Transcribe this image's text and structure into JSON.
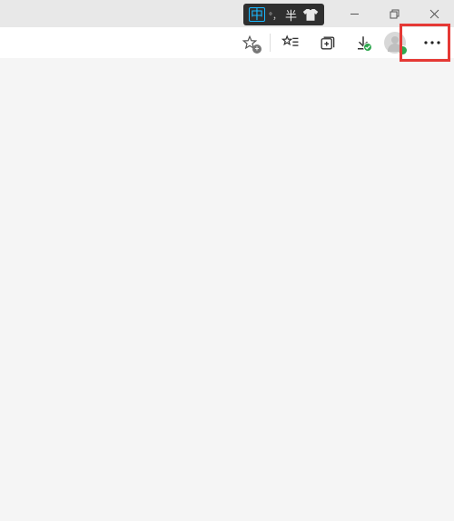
{
  "window_controls": {
    "minimize": "—",
    "maximize": "❐",
    "close": "✕"
  },
  "ime": {
    "mode": "中",
    "separator": "°，",
    "width": "半",
    "shirt_icon": "tshirt-icon"
  },
  "toolbar": {
    "add_favorite": "Add this page to favorites",
    "favorites": "Favorites",
    "collections": "Collections",
    "downloads": "Downloads",
    "profile": "Profile",
    "menu": "Settings and more"
  },
  "annotation": {
    "highlight_target": "menu-button"
  }
}
